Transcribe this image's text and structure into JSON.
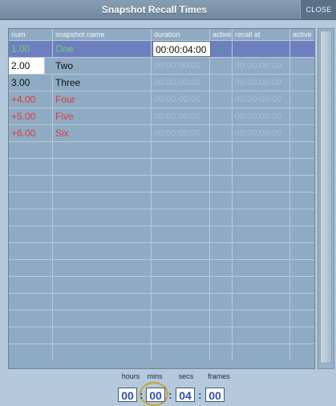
{
  "window": {
    "title": "Snapshot Recall Times",
    "close_label": "CLOSE"
  },
  "table": {
    "headers": {
      "num": "num",
      "name": "snapshot name",
      "duration": "duration",
      "active": "active",
      "recall_at": "recall at",
      "active2": "active"
    },
    "rows": [
      {
        "num": "1.00",
        "name": "One",
        "duration": "00:00:04:00",
        "active": "✓",
        "recall_at": "",
        "color": "green",
        "selected": true
      },
      {
        "num": "2.00",
        "name": "Two",
        "duration": "00:00:00:00",
        "active": "",
        "recall_at": "00:00:00:00",
        "color": "black"
      },
      {
        "num": "3.00",
        "name": "Three",
        "duration": "00:00:00:00",
        "active": "",
        "recall_at": "00:00:00:00",
        "color": "black"
      },
      {
        "num": "+4.00",
        "name": "Four",
        "duration": "00:00:00:00",
        "active": "",
        "recall_at": "00:00:00:00",
        "color": "red"
      },
      {
        "num": "+5.00",
        "name": "Five",
        "duration": "00:00:00:00",
        "active": "",
        "recall_at": "00:00:00:00",
        "color": "red"
      },
      {
        "num": "+6.00",
        "name": "Six",
        "duration": "00:00:00:00",
        "active": "",
        "recall_at": "00:00:00:00",
        "color": "red"
      }
    ]
  },
  "time_entry": {
    "labels": {
      "hours": "hours",
      "mins": "mins",
      "secs": "secs",
      "frames": "frames"
    },
    "values": {
      "hours": "00",
      "mins": "00",
      "secs": "04",
      "frames": "00"
    },
    "separator": ":"
  },
  "colors": {
    "selected_row": "#6e7fc0",
    "green_text": "#6ed06e",
    "red_text": "#e03a3a",
    "time_digits": "#2d4fb0"
  }
}
